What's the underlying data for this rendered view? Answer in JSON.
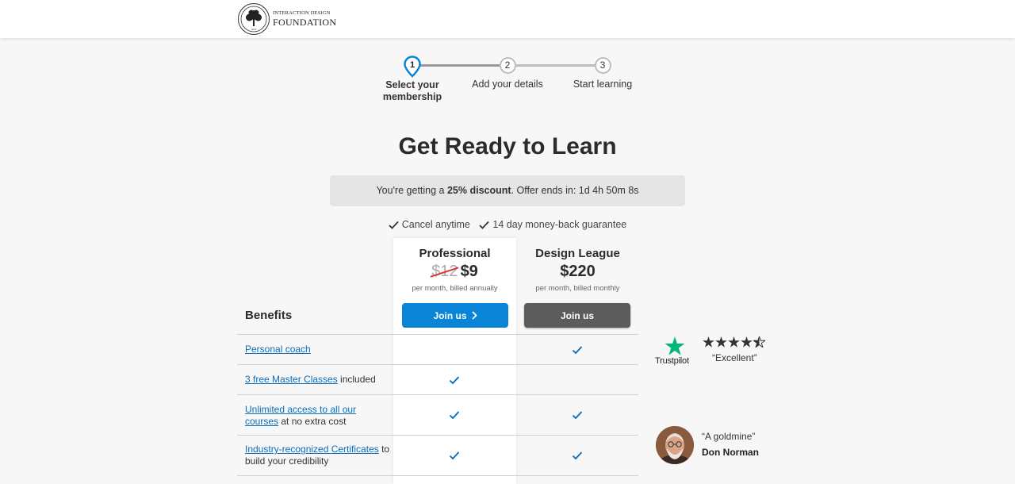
{
  "header": {
    "logo_line1": "INTERACTION DESIGN",
    "logo_line2": "FOUNDATION",
    "logo_seal_text": "IxDF"
  },
  "stepper": {
    "steps": [
      {
        "number": "1",
        "label": "Select your membership",
        "active": true
      },
      {
        "number": "2",
        "label": "Add your details",
        "active": false
      },
      {
        "number": "3",
        "label": "Start learning",
        "active": false
      }
    ]
  },
  "title": "Get Ready to Learn",
  "discount": {
    "prefix": "You're getting a ",
    "highlight": "25% discount",
    "suffix": ". Offer ends in: 1d 4h 50m 8s"
  },
  "guarantees": [
    "Cancel anytime",
    "14 day money-back guarantee"
  ],
  "plans": [
    {
      "name": "Professional",
      "old_price": "$12",
      "price": "$9",
      "billing": "per month, billed annually",
      "button": "Join us"
    },
    {
      "name": "Design League",
      "price": "$220",
      "billing": "per month, billed monthly",
      "button": "Join us"
    }
  ],
  "benefits": {
    "title": "Benefits",
    "rows": [
      {
        "link": "Personal coach",
        "rest": "",
        "professional": false,
        "league": true
      },
      {
        "link": "3 free Master Classes",
        "rest": " included",
        "professional": true,
        "league": false
      },
      {
        "link": "Unlimited access to all our courses",
        "rest": " at no extra cost",
        "professional": true,
        "league": true
      },
      {
        "link": "Industry-recognized Certificates",
        "rest": " to build your credibility",
        "professional": true,
        "league": true
      }
    ]
  },
  "trustpilot": {
    "brand": "Trustpilot",
    "quote": "“Excellent”",
    "stars": 4.5,
    "brand_color": "#00b67a"
  },
  "testimonial": {
    "quote": "“A goldmine”",
    "name": "Don Norman"
  },
  "colors": {
    "accent": "#0a84d6",
    "link": "#0a6ebd",
    "check": "#0a6ebd"
  }
}
